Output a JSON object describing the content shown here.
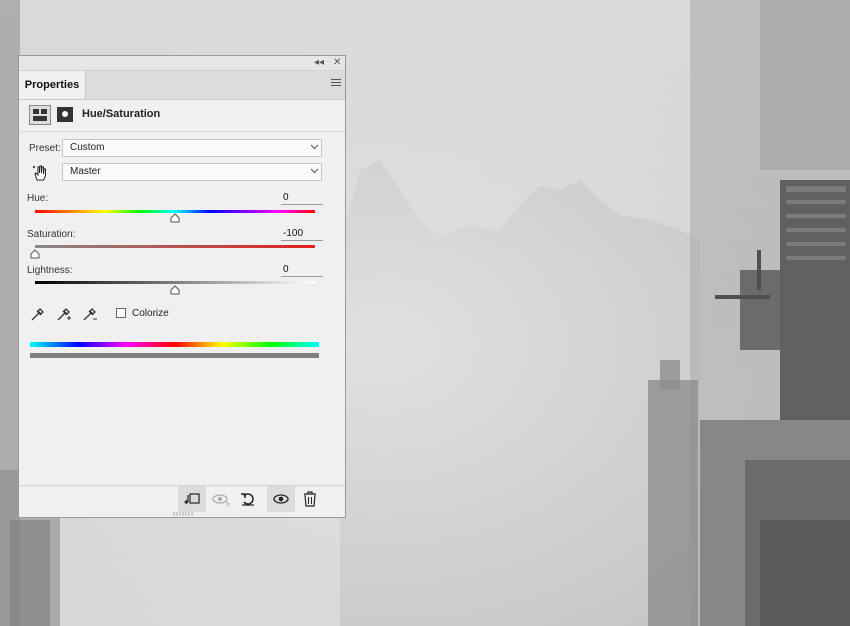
{
  "panel": {
    "tab_label": "Properties",
    "header_title": "Hue/Saturation",
    "preset": {
      "label": "Preset:",
      "value": "Custom"
    },
    "channel": {
      "value": "Master"
    },
    "hue": {
      "label": "Hue:",
      "value": "0",
      "fraction": 0.5
    },
    "saturation": {
      "label": "Saturation:",
      "value": "-100",
      "fraction": 0.0
    },
    "lightness": {
      "label": "Lightness:",
      "value": "0",
      "fraction": 0.5
    },
    "colorize": {
      "label": "Colorize",
      "checked": false
    }
  },
  "icons": {
    "titlebar": [
      "collapse-icon",
      "close-icon"
    ],
    "tools": [
      "eyedropper-icon",
      "eyedropper-plus-icon",
      "eyedropper-minus-icon"
    ],
    "bottom": [
      "clip-to-layer-icon",
      "view-previous-icon",
      "reset-icon",
      "visibility-icon",
      "trash-icon"
    ]
  },
  "colors": {
    "panel_bg": "#f0f0f0",
    "accent_red": "#e41f1f"
  }
}
